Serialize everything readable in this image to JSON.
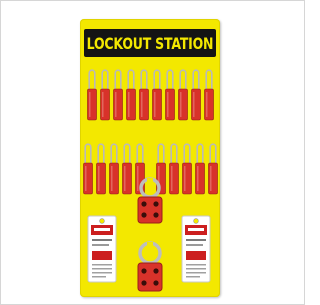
{
  "station": {
    "title": "LOCKOUT STATION",
    "board_color": "#f3e800",
    "header_color": "#141414",
    "lock_color": "#d8322a",
    "shackle_color": "#b9b9b9",
    "hasp_color": "#d8322a",
    "tag_color": "#ffffff",
    "tag_accent": "#cc1f1f",
    "row1_lock_count": 10,
    "row2_lock_count": 10,
    "hasp_count": 2,
    "tag_count": 2
  }
}
